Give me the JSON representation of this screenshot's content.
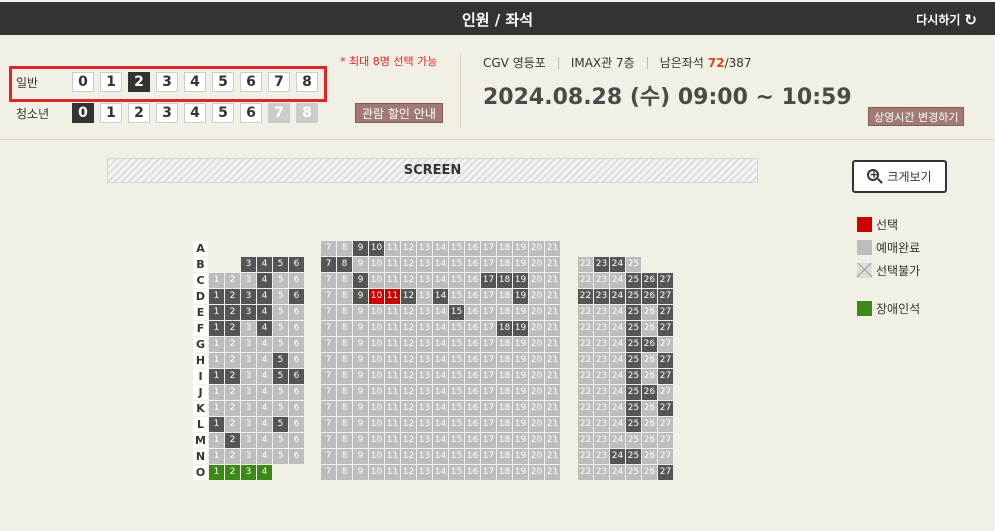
{
  "header": {
    "title": "인원 / 좌석",
    "reset_label": "다시하기",
    "reset_icon": "refresh-icon"
  },
  "people": {
    "general": {
      "label": "일반",
      "numbers": [
        "0",
        "1",
        "2",
        "3",
        "4",
        "5",
        "6",
        "7",
        "8"
      ],
      "selected": "2",
      "disabled": []
    },
    "youth": {
      "label": "청소년",
      "numbers": [
        "0",
        "1",
        "2",
        "3",
        "4",
        "5",
        "6",
        "7",
        "8"
      ],
      "selected": "0",
      "disabled": [
        "7",
        "8"
      ]
    },
    "max_note": "* 최대 8명 선택 가능",
    "discount_button": "관람 할인 안내"
  },
  "info": {
    "theater": "CGV 영등포",
    "hall": "IMAX관 7층",
    "remain_label": "남은좌석",
    "remain_count": "72",
    "remain_total": "/387",
    "datetime": "2024.08.28 (수) 09:00 ~ 10:59",
    "change_button": "상영시간 변경하기"
  },
  "screen_label": "SCREEN",
  "zoom_button": "크게보기",
  "legend": [
    {
      "key": "sel",
      "label": "선택"
    },
    {
      "key": "sold",
      "label": "예매완료"
    },
    {
      "key": "na",
      "label": "선택불가"
    },
    {
      "key": "hc",
      "label": "장애인석"
    }
  ],
  "colors": {
    "header": "#333333",
    "accent_red": "#e0242c",
    "selected": "#cc0000",
    "sold": "#555555",
    "available": "#bdbdbd",
    "handicap": "#3a8a15",
    "button_brown": "#a07a73"
  },
  "seat_rows": [
    {
      "row": "A",
      "left": [],
      "center_sold": [
        9,
        10
      ],
      "center_sel": [],
      "right": []
    },
    {
      "row": "B",
      "left": [
        3,
        4,
        5,
        6
      ],
      "left_sold": [
        3,
        4,
        5,
        6
      ],
      "center_sold": [
        7,
        8
      ],
      "center_sel": [],
      "right": [
        22,
        23,
        24,
        25
      ],
      "right_sold": [
        23,
        24
      ]
    },
    {
      "row": "C",
      "left": [
        1,
        2,
        3,
        4,
        5,
        6
      ],
      "left_sold": [
        4
      ],
      "center_sold": [
        9,
        17,
        18,
        19
      ],
      "center_sel": [],
      "right": [
        22,
        23,
        24,
        25,
        26,
        27
      ],
      "right_sold": [
        25,
        26,
        27
      ]
    },
    {
      "row": "D",
      "left": [
        1,
        2,
        3,
        4,
        5,
        6
      ],
      "left_sold": [
        1,
        2,
        3,
        4,
        6
      ],
      "center_sold": [
        9,
        12,
        14,
        19
      ],
      "center_sel": [
        10,
        11
      ],
      "right": [
        22,
        23,
        24,
        25,
        26,
        27
      ],
      "right_sold": [
        22,
        23,
        24,
        25,
        26,
        27
      ]
    },
    {
      "row": "E",
      "left": [
        1,
        2,
        3,
        4,
        5,
        6
      ],
      "left_sold": [
        1,
        2,
        3,
        4
      ],
      "center_sold": [
        15
      ],
      "center_sel": [],
      "right": [
        22,
        23,
        24,
        25,
        26,
        27
      ],
      "right_sold": [
        25,
        27
      ]
    },
    {
      "row": "F",
      "left": [
        1,
        2,
        3,
        4,
        5,
        6
      ],
      "left_sold": [
        1,
        2,
        4
      ],
      "center_sold": [
        18,
        19
      ],
      "center_sel": [],
      "right": [
        22,
        23,
        24,
        25,
        26,
        27
      ],
      "right_sold": [
        25,
        27
      ]
    },
    {
      "row": "G",
      "left": [
        1,
        2,
        3,
        4,
        5,
        6
      ],
      "left_sold": [],
      "center_sold": [],
      "center_sel": [],
      "right": [
        22,
        23,
        24,
        25,
        26,
        27
      ],
      "right_sold": [
        25,
        26
      ]
    },
    {
      "row": "H",
      "left": [
        1,
        2,
        3,
        4,
        5,
        6
      ],
      "left_sold": [
        5
      ],
      "center_sold": [],
      "center_sel": [],
      "right": [
        22,
        23,
        24,
        25,
        26,
        27
      ],
      "right_sold": [
        25,
        27
      ]
    },
    {
      "row": "I",
      "left": [
        1,
        2,
        3,
        4,
        5,
        6
      ],
      "left_sold": [
        1,
        2,
        5,
        6
      ],
      "center_sold": [],
      "center_sel": [],
      "right": [
        22,
        23,
        24,
        25,
        26,
        27
      ],
      "right_sold": [
        25,
        27
      ]
    },
    {
      "row": "J",
      "left": [
        1,
        2,
        3,
        4,
        5,
        6
      ],
      "left_sold": [],
      "center_sold": [],
      "center_sel": [],
      "right": [
        22,
        23,
        24,
        25,
        26,
        27
      ],
      "right_sold": [
        25,
        26
      ]
    },
    {
      "row": "K",
      "left": [
        1,
        2,
        3,
        4,
        5,
        6
      ],
      "left_sold": [],
      "center_sold": [],
      "center_sel": [],
      "right": [
        22,
        23,
        24,
        25,
        26,
        27
      ],
      "right_sold": [
        25,
        27
      ]
    },
    {
      "row": "L",
      "left": [
        1,
        2,
        3,
        4,
        5,
        6
      ],
      "left_sold": [
        1,
        5
      ],
      "center_sold": [],
      "center_sel": [],
      "right": [
        22,
        23,
        24,
        25,
        26,
        27
      ],
      "right_sold": [
        25
      ]
    },
    {
      "row": "M",
      "left": [
        1,
        2,
        3,
        4,
        5,
        6
      ],
      "left_sold": [
        2
      ],
      "center_sold": [],
      "center_sel": [],
      "right": [
        22,
        23,
        24,
        25,
        26,
        27
      ],
      "right_sold": []
    },
    {
      "row": "N",
      "left": [
        1,
        2,
        3,
        4,
        5,
        6
      ],
      "left_sold": [],
      "center_sold": [],
      "center_sel": [],
      "right": [
        22,
        23,
        24,
        25,
        26,
        27
      ],
      "right_sold": [
        24,
        25
      ]
    },
    {
      "row": "O",
      "left": [
        1,
        2,
        3,
        4
      ],
      "left_hc": [
        1,
        2,
        3,
        4
      ],
      "left_sold": [],
      "center_sold": [],
      "center_sel": [],
      "right": [
        22,
        23,
        24,
        25,
        26,
        27
      ],
      "right_sold": [
        27
      ]
    }
  ],
  "center_seat_numbers": [
    7,
    8,
    9,
    10,
    11,
    12,
    13,
    14,
    15,
    16,
    17,
    18,
    19,
    20,
    21
  ]
}
